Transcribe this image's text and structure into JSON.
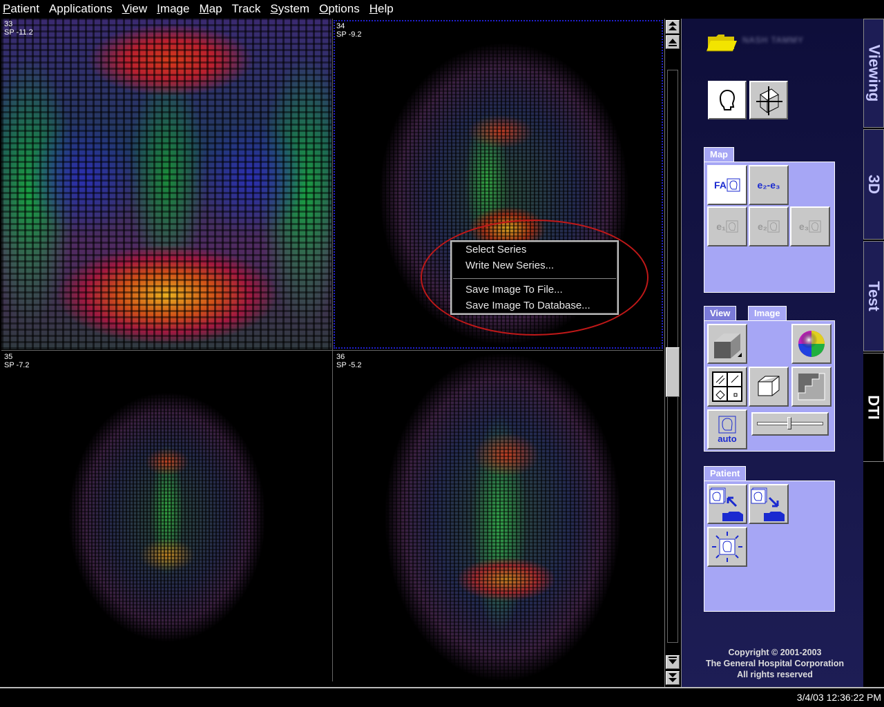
{
  "menubar": {
    "items": [
      {
        "mnemonic": "P",
        "rest": "atient"
      },
      {
        "mnemonic": "",
        "rest": "Applications"
      },
      {
        "mnemonic": "V",
        "rest": "iew"
      },
      {
        "mnemonic": "I",
        "rest": "mage"
      },
      {
        "mnemonic": "M",
        "rest": "ap"
      },
      {
        "mnemonic": "",
        "rest": "Track"
      },
      {
        "mnemonic": "S",
        "rest": "ystem"
      },
      {
        "mnemonic": "O",
        "rest": "ptions"
      },
      {
        "mnemonic": "H",
        "rest": "elp"
      }
    ]
  },
  "viewports": [
    {
      "number": "33",
      "position": "SP -11.2"
    },
    {
      "number": "34",
      "position": "SP -9.2"
    },
    {
      "number": "35",
      "position": "SP -7.2"
    },
    {
      "number": "36",
      "position": "SP -5.2"
    }
  ],
  "context_menu": {
    "items": [
      "Select Series",
      "Write New Series...",
      "Save Image To File...",
      "Save Image To Database..."
    ]
  },
  "panel": {
    "patient_name": "NASH TAMMY",
    "map_tab": "Map",
    "map_buttons": {
      "fa": "FA",
      "e2e3": "e₂-e₃",
      "e1": "e₁",
      "e2": "e₂",
      "e3": "e₃"
    },
    "view_tab": "View",
    "image_tab": "Image",
    "auto_label": "auto",
    "slider_value": 0.48,
    "patient_tab": "Patient",
    "copyright": [
      "Copyright © 2001-2003",
      "The General Hospital Corporation",
      "All rights reserved"
    ]
  },
  "side_tabs": [
    "Viewing",
    "3D",
    "Test",
    "DTI"
  ],
  "active_side_tab": "DTI",
  "status": {
    "timestamp": "3/4/03 12:36:22 PM"
  },
  "scroll_position": 0.53,
  "colors": {
    "panel_bg": "#1d1d55",
    "group_bg": "#a6a6f5",
    "annotation": "#c01818",
    "selection": "#2020d0"
  }
}
